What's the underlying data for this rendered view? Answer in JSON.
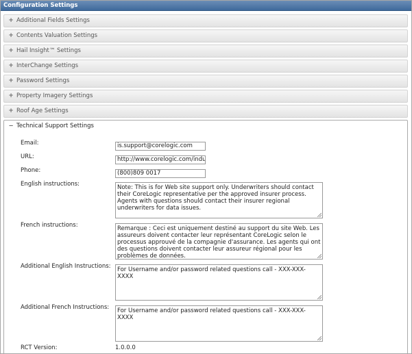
{
  "window": {
    "title": "Configuration Settings"
  },
  "sections": [
    {
      "label": "Additional Fields Settings",
      "sign": "+"
    },
    {
      "label": "Contents Valuation Settings",
      "sign": "+"
    },
    {
      "label": "Hail Insight™ Settings",
      "sign": "+"
    },
    {
      "label": "InterChange Settings",
      "sign": "+"
    },
    {
      "label": "Password Settings",
      "sign": "+"
    },
    {
      "label": "Property Imagery Settings",
      "sign": "+"
    },
    {
      "label": "Roof Age Settings",
      "sign": "+"
    },
    {
      "label": "Technical Support Settings",
      "sign": "−"
    }
  ],
  "support": {
    "email_label": "Email:",
    "email_value": "is.support@corelogic.com",
    "url_label": "URL:",
    "url_value": "http://www.corelogic.com/industry",
    "phone_label": "Phone:",
    "phone_value": "(800)809 0017",
    "english_label": "English instructions:",
    "english_value": "Note: This is for Web site support only. Underwriters should contact their CoreLogic representative per the approved insurer process. Agents with questions should contact their insurer regional underwriters for data issues.",
    "french_label": "French instructions:",
    "french_value": "Remarque : Ceci est uniquement destiné au support du site Web. Les assureurs doivent contacter leur représentant CoreLogic selon le processus approuvé de la compagnie d'assurance. Les agents qui ont des questions doivent contacter leur assureur régional pour les problèmes de données.",
    "add_english_label": "Additional English Instructions:",
    "add_english_value": "For Username and/or password related questions call - XXX-XXX-XXXX",
    "add_french_label": "Additional French Instructions:",
    "add_french_value": "For Username and/or password related questions call - XXX-XXX-XXXX",
    "rct_label": "RCT Version:",
    "rct_value": "1.0.0.0"
  }
}
